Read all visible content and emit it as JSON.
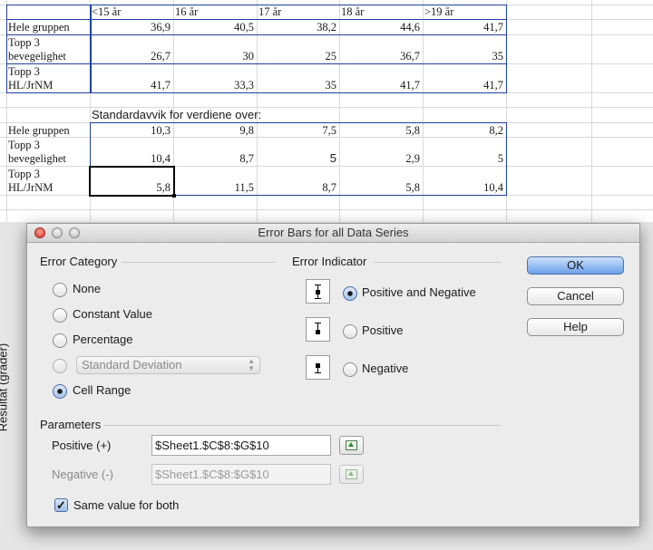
{
  "sheet": {
    "header": [
      "<15 år",
      "16 år",
      "17 år",
      "18 år",
      ">19 år"
    ],
    "rows1": [
      {
        "label1": "Hele gruppen",
        "label2": "",
        "values": [
          "36,9",
          "40,5",
          "38,2",
          "44,6",
          "41,7"
        ]
      },
      {
        "label1": "Topp 3",
        "label2": "bevegelighet",
        "values": [
          "26,7",
          "30",
          "25",
          "36,7",
          "35"
        ]
      },
      {
        "label1": "Topp 3",
        "label2": "HL/JrNM",
        "values": [
          "41,7",
          "33,3",
          "35",
          "41,7",
          "41,7"
        ]
      }
    ],
    "std_title": "Standardavvik for verdiene over:",
    "rows2": [
      {
        "label1": "Hele gruppen",
        "label2": "",
        "values": [
          "10,3",
          "9,8",
          "7,5",
          "5,8",
          "8,2"
        ]
      },
      {
        "label1": "Topp 3",
        "label2": "bevegelighet",
        "values": [
          "10,4",
          "8,7",
          "5",
          "2,9",
          "5"
        ]
      },
      {
        "label1": "Topp 3",
        "label2": "HL/JrNM",
        "values": [
          "5,8",
          "11,5",
          "8,7",
          "5,8",
          "10,4"
        ]
      }
    ],
    "chart_ylabel": "Resultat (grader)"
  },
  "dialog": {
    "title": "Error Bars for all Data Series",
    "error_category": {
      "heading": "Error Category",
      "options": [
        "None",
        "Constant Value",
        "Percentage",
        "Standard Deviation",
        "Cell Range"
      ],
      "selected": "Cell Range",
      "std_select_value": "Standard Deviation"
    },
    "error_indicator": {
      "heading": "Error Indicator",
      "options": [
        "Positive and Negative",
        "Positive",
        "Negative"
      ],
      "selected": "Positive and Negative",
      "icons": [
        "error-bar-both-icon",
        "error-bar-positive-icon",
        "error-bar-negative-icon"
      ]
    },
    "buttons": {
      "ok": "OK",
      "cancel": "Cancel",
      "help": "Help"
    },
    "parameters": {
      "heading": "Parameters",
      "positive_label": "Positive (+)",
      "positive_value": "$Sheet1.$C$8:$G$10",
      "negative_label": "Negative (-)",
      "negative_value": "$Sheet1.$C$8:$G$10",
      "same_value_label": "Same value for both",
      "same_value_checked": true
    },
    "colors": {
      "default_button": "#6aa1ea",
      "cell_border": "#2040a0"
    }
  }
}
